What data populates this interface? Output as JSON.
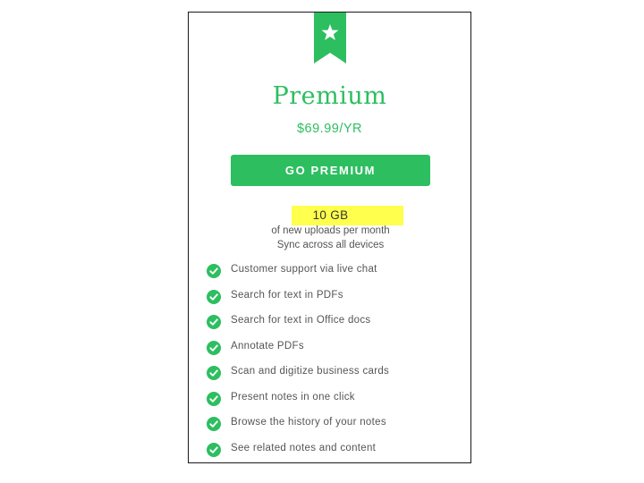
{
  "plan": {
    "name": "Premium",
    "price": "$69.99/YR",
    "cta_label": "GO PREMIUM",
    "storage_amount": "10 GB",
    "storage_line1": "of new uploads per month",
    "storage_line2": "Sync across all devices",
    "ribbon_icon": "star-icon",
    "accent_color": "#2dbe60",
    "highlight_color": "#ffff4d"
  },
  "features": [
    {
      "label": "Customer support via live chat",
      "icon": "check-circle-icon"
    },
    {
      "label": "Search for text in PDFs",
      "icon": "check-circle-icon"
    },
    {
      "label": "Search for text in Office docs",
      "icon": "check-circle-icon"
    },
    {
      "label": "Annotate PDFs",
      "icon": "check-circle-icon"
    },
    {
      "label": "Scan and digitize business cards",
      "icon": "check-circle-icon"
    },
    {
      "label": "Present notes in one click",
      "icon": "check-circle-icon"
    },
    {
      "label": "Browse the history of your notes",
      "icon": "check-circle-icon"
    },
    {
      "label": "See related notes and content",
      "icon": "check-circle-icon"
    }
  ]
}
